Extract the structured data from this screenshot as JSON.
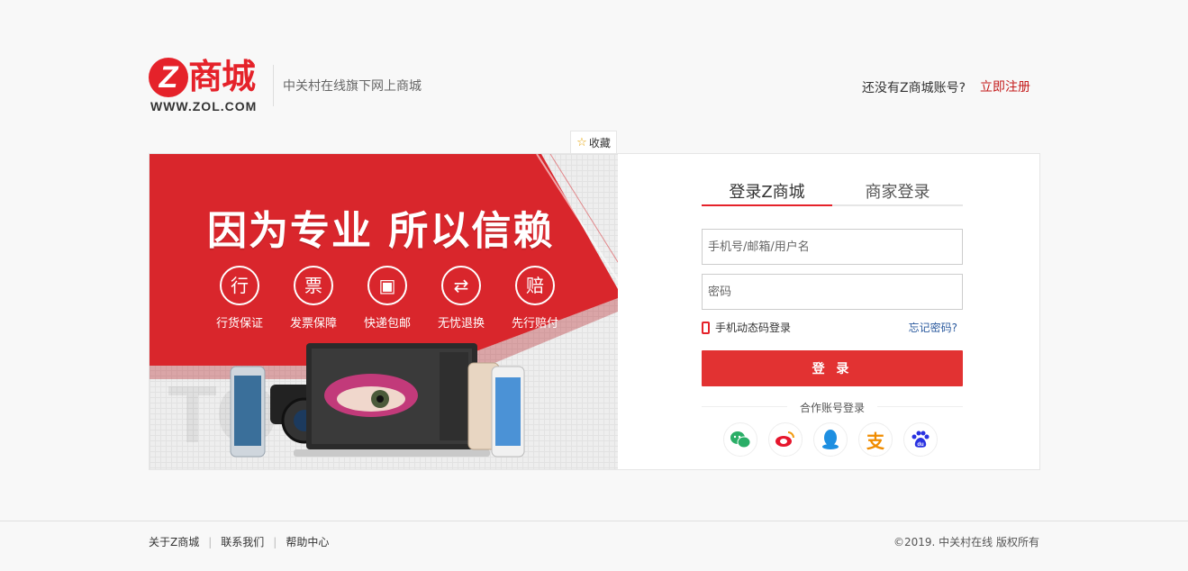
{
  "header": {
    "logo_letter": "Z",
    "logo_name": "商城",
    "logo_url": "WWW.ZOL.COM",
    "slogan": "中关村在线旗下网上商城",
    "register_prompt": "还没有Z商城账号?",
    "register_link": "立即注册"
  },
  "favorite": {
    "label": "收藏",
    "icon": "star-icon"
  },
  "banner": {
    "headline": "因为专业 所以信赖",
    "features": [
      {
        "glyph": "行",
        "label": "行货保证"
      },
      {
        "glyph": "票",
        "label": "发票保障"
      },
      {
        "glyph": "▣",
        "label": "快递包邮"
      },
      {
        "glyph": "⇄",
        "label": "无忧退换"
      },
      {
        "glyph": "赔",
        "label": "先行赔付"
      }
    ]
  },
  "login": {
    "tabs": [
      {
        "label": "登录Z商城",
        "active": true
      },
      {
        "label": "商家登录",
        "active": false
      }
    ],
    "username_placeholder": "手机号/邮箱/用户名",
    "password_placeholder": "密码",
    "sms_login": "手机动态码登录",
    "forgot_password": "忘记密码?",
    "submit": "登 录",
    "partner_title": "合作账号登录",
    "socials": [
      {
        "name": "wechat-icon",
        "glyph": "💬",
        "color": "#2aae67"
      },
      {
        "name": "weibo-icon",
        "glyph": "◉",
        "color": "#e6162d"
      },
      {
        "name": "qq-icon",
        "glyph": "🐧",
        "color": "#1e8fe1"
      },
      {
        "name": "alipay-icon",
        "glyph": "支",
        "color": "#f08c00"
      },
      {
        "name": "baidu-icon",
        "glyph": "du",
        "color": "#2932e1"
      }
    ]
  },
  "footer": {
    "links": [
      "关于Z商城",
      "联系我们",
      "帮助中心"
    ],
    "copyright": "©2019. 中关村在线 版权所有"
  },
  "colors": {
    "brand_red": "#e5222a",
    "button_red": "#e23232",
    "link_blue": "#2b5a9e"
  }
}
